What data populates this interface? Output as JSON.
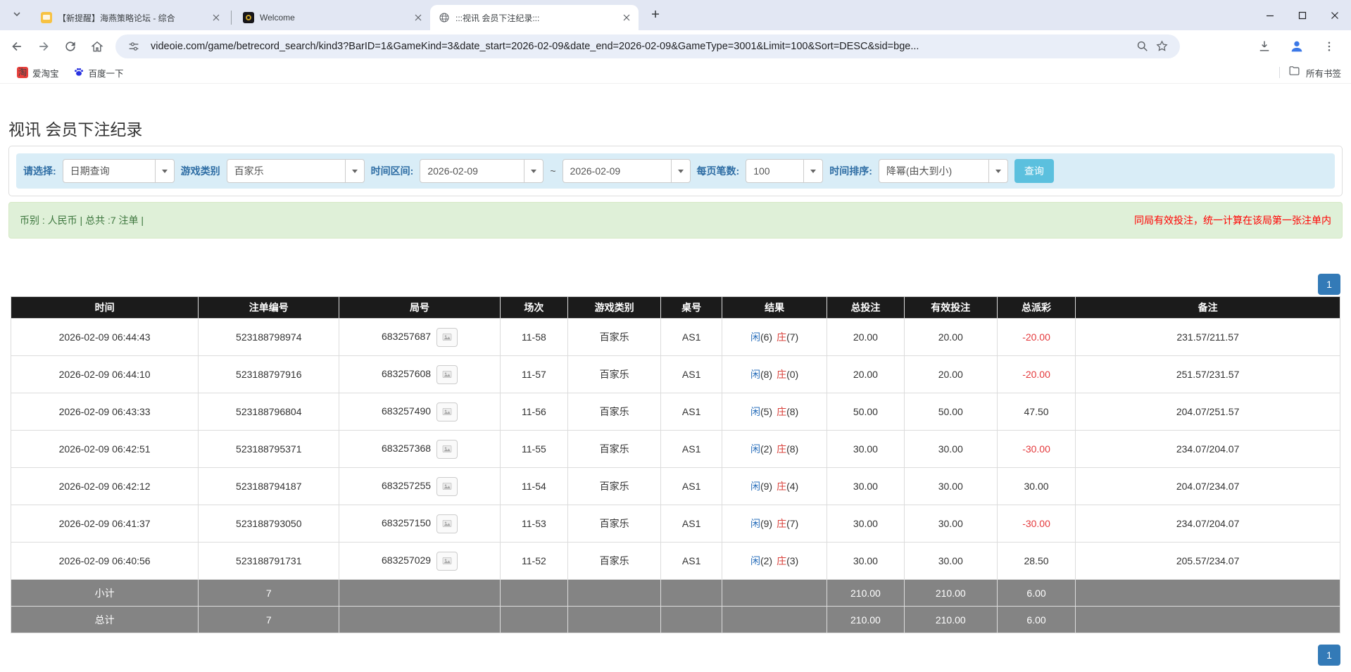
{
  "browser": {
    "tabs": [
      {
        "title": "【新提醒】海燕策略论坛 - 综合",
        "active": false
      },
      {
        "title": "Welcome",
        "active": false
      },
      {
        "title": ":::视讯 会员下注纪录:::",
        "active": true
      }
    ],
    "url": "videoie.com/game/betrecord_search/kind3?BarID=1&GameKind=3&date_start=2026-02-09&date_end=2026-02-09&GameType=3001&Limit=100&Sort=DESC&sid=bge...",
    "bookmarks": [
      {
        "label": "爱淘宝",
        "icon_text": "淘"
      },
      {
        "label": "百度一下"
      }
    ],
    "all_bookmarks_label": "所有书签"
  },
  "page": {
    "title": "视讯 会员下注纪录",
    "filters": {
      "select_label": "请选择:",
      "select_value": "日期查询",
      "game_label": "游戏类别",
      "game_value": "百家乐",
      "range_label": "时间区间:",
      "date_start": "2026-02-09",
      "tilde": "~",
      "date_end": "2026-02-09",
      "page_size_label": "每页笔数:",
      "page_size_value": "100",
      "sort_label": "时间排序:",
      "sort_value": "降幂(由大到小)",
      "query_button": "查询"
    },
    "summary": {
      "left": "币别 : 人民币 | 总共 :7 注单 |",
      "right": "同局有效投注，统一计算在该局第一张注单内"
    },
    "pagination": {
      "label": "1"
    },
    "table": {
      "headers": [
        "时间",
        "注单编号",
        "局号",
        "场次",
        "游戏类别",
        "桌号",
        "结果",
        "总投注",
        "有效投注",
        "总派彩",
        "备注"
      ],
      "rows": [
        {
          "time": "2026-02-09 06:44:43",
          "bet_id": "523188798974",
          "round_id": "683257687",
          "session": "11-58",
          "game": "百家乐",
          "table_no": "AS1",
          "player_label": "闲",
          "player_score": "(6)",
          "banker_label": "庄",
          "banker_score": "(7)",
          "total_bet": "20.00",
          "valid_bet": "20.00",
          "payout": "-20.00",
          "note": "231.57/211.57"
        },
        {
          "time": "2026-02-09 06:44:10",
          "bet_id": "523188797916",
          "round_id": "683257608",
          "session": "11-57",
          "game": "百家乐",
          "table_no": "AS1",
          "player_label": "闲",
          "player_score": "(8)",
          "banker_label": "庄",
          "banker_score": "(0)",
          "total_bet": "20.00",
          "valid_bet": "20.00",
          "payout": "-20.00",
          "note": "251.57/231.57"
        },
        {
          "time": "2026-02-09 06:43:33",
          "bet_id": "523188796804",
          "round_id": "683257490",
          "session": "11-56",
          "game": "百家乐",
          "table_no": "AS1",
          "player_label": "闲",
          "player_score": "(5)",
          "banker_label": "庄",
          "banker_score": "(8)",
          "total_bet": "50.00",
          "valid_bet": "50.00",
          "payout": "47.50",
          "note": "204.07/251.57"
        },
        {
          "time": "2026-02-09 06:42:51",
          "bet_id": "523188795371",
          "round_id": "683257368",
          "session": "11-55",
          "game": "百家乐",
          "table_no": "AS1",
          "player_label": "闲",
          "player_score": "(2)",
          "banker_label": "庄",
          "banker_score": "(8)",
          "total_bet": "30.00",
          "valid_bet": "30.00",
          "payout": "-30.00",
          "note": "234.07/204.07"
        },
        {
          "time": "2026-02-09 06:42:12",
          "bet_id": "523188794187",
          "round_id": "683257255",
          "session": "11-54",
          "game": "百家乐",
          "table_no": "AS1",
          "player_label": "闲",
          "player_score": "(9)",
          "banker_label": "庄",
          "banker_score": "(4)",
          "total_bet": "30.00",
          "valid_bet": "30.00",
          "payout": "30.00",
          "note": "204.07/234.07"
        },
        {
          "time": "2026-02-09 06:41:37",
          "bet_id": "523188793050",
          "round_id": "683257150",
          "session": "11-53",
          "game": "百家乐",
          "table_no": "AS1",
          "player_label": "闲",
          "player_score": "(9)",
          "banker_label": "庄",
          "banker_score": "(7)",
          "total_bet": "30.00",
          "valid_bet": "30.00",
          "payout": "-30.00",
          "note": "234.07/204.07"
        },
        {
          "time": "2026-02-09 06:40:56",
          "bet_id": "523188791731",
          "round_id": "683257029",
          "session": "11-52",
          "game": "百家乐",
          "table_no": "AS1",
          "player_label": "闲",
          "player_score": "(2)",
          "banker_label": "庄",
          "banker_score": "(3)",
          "total_bet": "30.00",
          "valid_bet": "30.00",
          "payout": "28.50",
          "note": "205.57/234.07"
        }
      ],
      "subtotal": {
        "label": "小计",
        "count": "7",
        "total_bet": "210.00",
        "valid_bet": "210.00",
        "payout": "6.00"
      },
      "total": {
        "label": "总计",
        "count": "7",
        "total_bet": "210.00",
        "valid_bet": "210.00",
        "payout": "6.00"
      }
    }
  },
  "colors": {
    "tabbar_bg": "#e2e7f3",
    "omnibox_bg": "#e9eef8",
    "filter_bar_bg": "#d9edf7",
    "query_button": "#5bc0de",
    "alert_green_bg": "#dff0d8",
    "notice_red": "#ff0000",
    "pagination_blue": "#337ab7",
    "header_black": "#1b1b1b",
    "footer_gray": "#848484",
    "player_blue": "#2a6fbb",
    "banker_red": "#d9403a",
    "amount_blue": "#2e7bd6",
    "negative_red": "#e4393c"
  }
}
